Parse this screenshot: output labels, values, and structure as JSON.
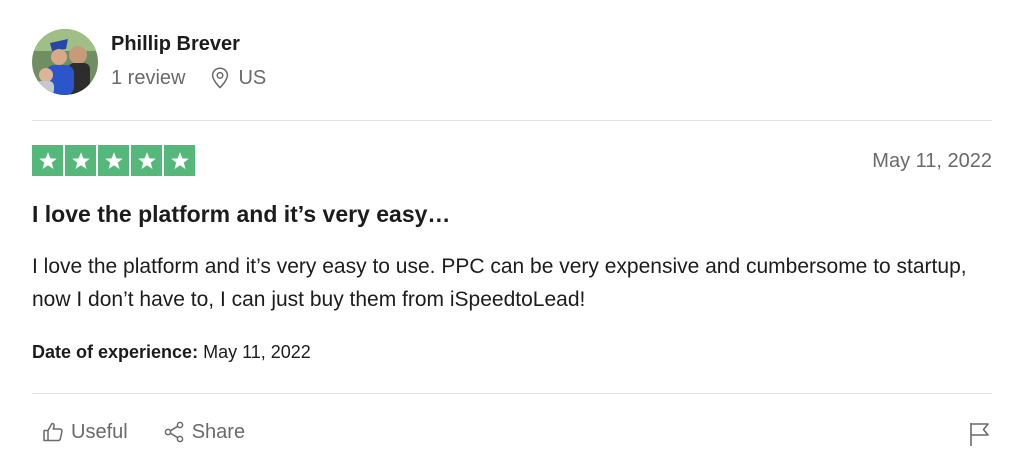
{
  "reviewer": {
    "name": "Phillip Brever",
    "review_count": "1 review",
    "country": "US",
    "avatar_icon": "user-photo-avatar"
  },
  "review": {
    "rating": 5,
    "rating_max": 5,
    "star_color": "#55b779",
    "date": "May 11, 2022",
    "title": "I love the platform and it’s very easy…",
    "body": "I love the platform and it’s very easy to use. PPC can be very expensive and cumbersome to startup, now I don’t have to, I can just buy them from iSpeedtoLead!",
    "experience_label": "Date of experience:",
    "experience_date": "May 11, 2022"
  },
  "actions": {
    "useful_label": "Useful",
    "share_label": "Share",
    "icons": [
      "thumbs-up-icon",
      "share-icon",
      "flag-icon"
    ]
  }
}
